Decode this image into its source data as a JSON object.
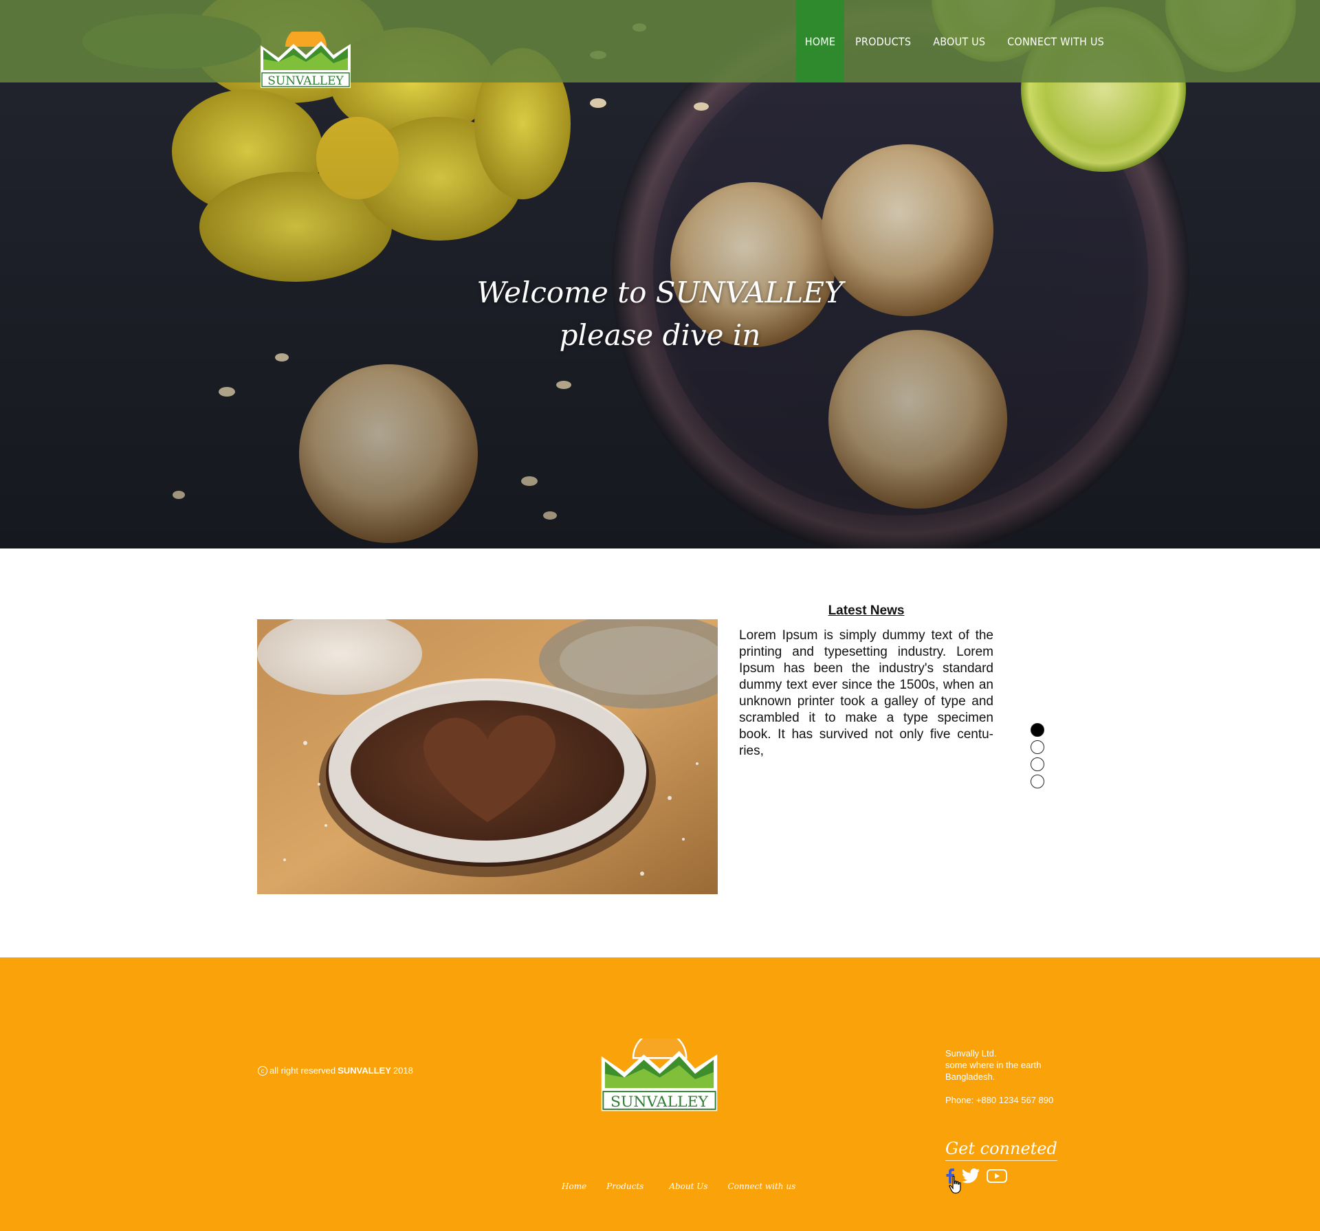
{
  "brand": {
    "name": "SUNVALLEY"
  },
  "nav": {
    "items": [
      {
        "label": "HOME",
        "active": true
      },
      {
        "label": "PRODUCTS"
      },
      {
        "label": "ABOUT US"
      },
      {
        "label": "CONNECT WITH US"
      }
    ]
  },
  "hero": {
    "line1": "Welcome to SUNVALLEY",
    "line2": "please dive in"
  },
  "news": {
    "title": "Latest News",
    "body": "Lorem Ipsum is simply dummy text of the printing and typesetting industry. Lorem Ipsum has been the industry's standard dummy text ever since the 1500s, when an unknown printer took a galley of type and scrambled it to make a type specimen book. It has survived not only five centu-ries,",
    "slider": {
      "count": 4,
      "active_index": 0
    }
  },
  "footer": {
    "copyright_prefix": "all right reserved",
    "copyright_brand": "SUNVALLEY",
    "copyright_year": "2018",
    "address": {
      "company": "Sunvally Ltd.",
      "line1": "some where in the earth",
      "line2": "Bangladesh.",
      "phone": "Phone: +880 1234 567 890"
    },
    "get_connected": "Get conneted",
    "socials": [
      "facebook-icon",
      "twitter-icon",
      "youtube-icon"
    ],
    "nav": [
      "Home",
      "Products",
      "About Us",
      "Connect with us"
    ]
  },
  "colors": {
    "topbar": "#62823e",
    "nav_active": "#2f8a2e",
    "footer": "#f9a20a",
    "logo_green": "#2e7d32",
    "logo_sun": "#f6a623"
  }
}
